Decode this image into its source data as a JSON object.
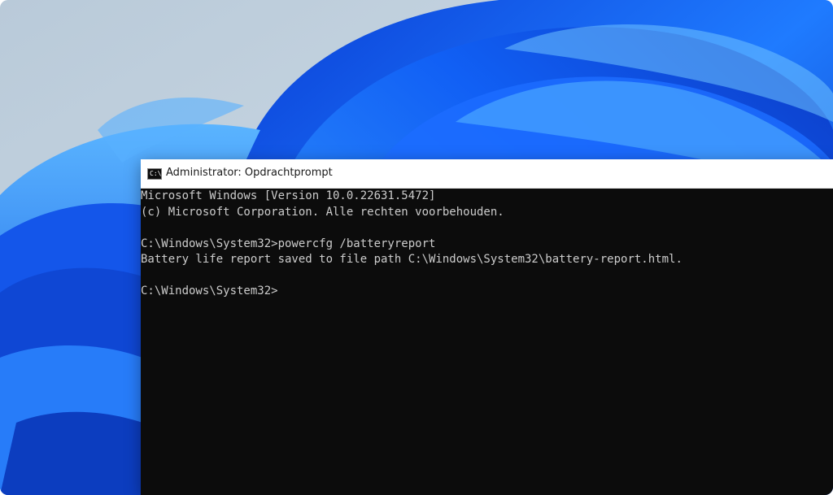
{
  "window": {
    "title": "Administrator: Opdrachtprompt",
    "icon": "cmd-icon",
    "icon_glyph": "C:\\"
  },
  "console": {
    "lines": [
      "Microsoft Windows [Version 10.0.22631.5472]",
      "(c) Microsoft Corporation. Alle rechten voorbehouden.",
      "",
      "C:\\Windows\\System32>powercfg /batteryreport",
      "Battery life report saved to file path C:\\Windows\\System32\\battery-report.html.",
      "",
      "C:\\Windows\\System32>"
    ]
  },
  "colors": {
    "console_background": "#0c0c0c",
    "console_text": "#cccccc",
    "titlebar_background": "#ffffff",
    "wallpaper_accent": "#1a6fff"
  }
}
